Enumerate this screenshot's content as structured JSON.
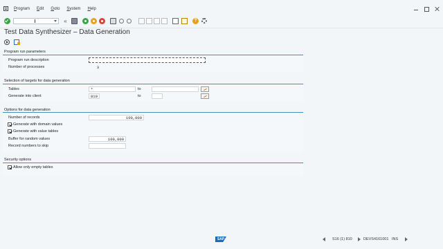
{
  "menu": {
    "items": [
      "Program",
      "Edit",
      "Goto",
      "System",
      "Help"
    ]
  },
  "window": {
    "title": "Test Data Synthesizer – Data Generation"
  },
  "sections": {
    "program_run": {
      "title": "Program run parameters",
      "run_description_label": "Program run description",
      "run_description_value": "",
      "processes_label": "Number of processes",
      "processes_value": "3"
    },
    "targets": {
      "title": "Selection of targets for data generation",
      "tables_label": "Tables",
      "tables_value": "*",
      "tables_to_label": "to",
      "tables_to_value": "",
      "client_label": "Generate into client",
      "client_value": "810",
      "client_to_label": "to",
      "client_to_value": ""
    },
    "options": {
      "title": "Options for data generation",
      "records_label": "Number of records",
      "records_value": "100,000",
      "domain_values_label": "Generate with domain values",
      "domain_values_checked": true,
      "value_tables_label": "Generate with value tables",
      "value_tables_checked": true,
      "buffer_label": "Buffer for random values",
      "buffer_value": "100,000",
      "skip_label": "Record numbers to skip",
      "skip_value": ""
    },
    "security": {
      "title": "Security options",
      "empty_tables_label": "Allow only empty tables",
      "empty_tables_checked": true
    }
  },
  "statusbar": {
    "logo": "SAP",
    "system": "S16 (1) 810",
    "server": "DEVS4161001",
    "mode": "INS"
  },
  "colors": {
    "section_line": "#3a93b8",
    "background": "#f2f6f9",
    "ok_green": "#3aa34a"
  }
}
